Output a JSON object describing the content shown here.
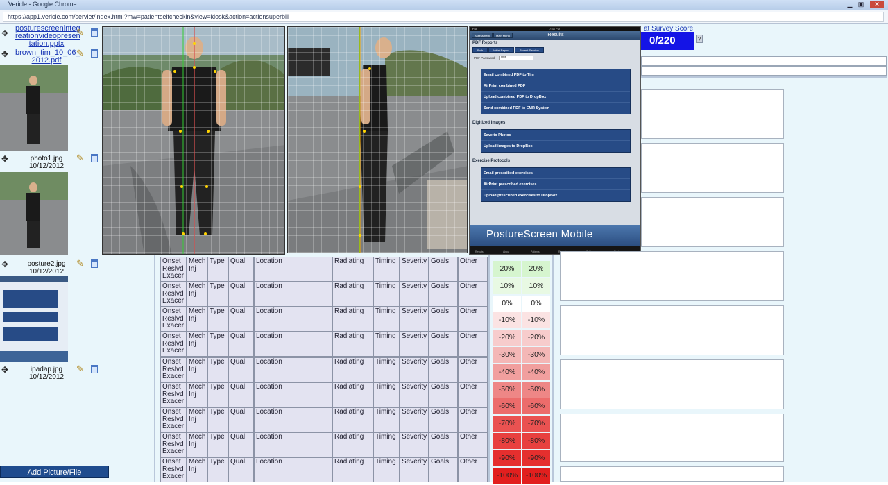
{
  "browser": {
    "window_title": "Vericle - Google Chrome",
    "url": "https://app1.vericle.com/servlet/index.html?mw=patientselfcheckin&view=kiosk&action=actionsuperbill"
  },
  "files": [
    {
      "name_lines": [
        "posturescreeninteg",
        "reationvideopresen",
        "tation.pptx"
      ],
      "date": "",
      "link": true
    },
    {
      "name_lines": [
        "brown_tim_10_06_",
        "2012.pdf"
      ],
      "date": "",
      "link": true
    },
    {
      "name_lines": [
        "photo1.jpg"
      ],
      "date": "10/12/2012",
      "link": false
    },
    {
      "name_lines": [
        "posture2.jpg"
      ],
      "date": "10/12/2012",
      "link": false
    },
    {
      "name_lines": [
        "ipadap.jpg"
      ],
      "date": "10/12/2012",
      "link": false
    }
  ],
  "add_button": "Add Picture/File",
  "ipad": {
    "status_left": "iPad",
    "status_time": "7:33 PM",
    "nav_left": "Assessment",
    "nav_mid": "Main Menu",
    "nav_title": "Results",
    "pdf_section": "PDF Reports",
    "pdf_tabs": [
      "Both",
      "Initial Report",
      "Recent Session"
    ],
    "pdf_password_label": "PDF Password",
    "pdf_password_value": "****",
    "pdf_actions": [
      "Email combined PDF to Tim",
      "AirPrint combined PDF",
      "Upload combined PDF to DropBox",
      "Send combined PDF to EMR System"
    ],
    "images_section": "Digitized Images",
    "image_actions": [
      "Save to Photos",
      "Upload images to DropBox"
    ],
    "exercise_section": "Exercise Protocols",
    "exercise_actions": [
      "Email prescribed exercises",
      "AirPrint prescribed exercises",
      "Upload prescribed exercises to DropBox"
    ],
    "logo": "PostureScreen Mobile",
    "tabs": [
      "Results",
      "About",
      "Patients",
      "Report",
      "Settings",
      "Next"
    ]
  },
  "survey": {
    "title": "at Survey Score",
    "score": "0/220",
    "help": "?"
  },
  "complaint_headers": {
    "onset": [
      "Onset",
      "Reslvd",
      "Exacer"
    ],
    "mech": [
      "Mech",
      "Inj"
    ],
    "type": "Type",
    "qual": "Qual",
    "location": "Location",
    "radiating": "Radiating",
    "timing": "Timing",
    "severity": "Severity",
    "goals": "Goals",
    "other": "Other"
  },
  "pain_scale": [
    {
      "a": "20%",
      "b": "20%",
      "color": "#d6f5cf"
    },
    {
      "a": "10%",
      "b": "10%",
      "color": "#e8f9e3"
    },
    {
      "a": "0%",
      "b": "0%",
      "color": "#ffffff"
    },
    {
      "a": "-10%",
      "b": "-10%",
      "color": "#fbe3e3"
    },
    {
      "a": "-20%",
      "b": "-20%",
      "color": "#f7cccc"
    },
    {
      "a": "-30%",
      "b": "-30%",
      "color": "#f4b7b6"
    },
    {
      "a": "-40%",
      "b": "-40%",
      "color": "#f19f9e"
    },
    {
      "a": "-50%",
      "b": "-50%",
      "color": "#ee8786"
    },
    {
      "a": "-60%",
      "b": "-60%",
      "color": "#ec6c6b"
    },
    {
      "a": "-70%",
      "b": "-70%",
      "color": "#ea5251"
    },
    {
      "a": "-80%",
      "b": "-80%",
      "color": "#e8403f"
    },
    {
      "a": "-90%",
      "b": "-90%",
      "color": "#e52f2e"
    },
    {
      "a": "-100%",
      "b": "-100%",
      "color": "#e21f1e"
    }
  ],
  "colors": {
    "link": "#1a37b5",
    "page_bg": "#e9f6fb",
    "cell_bg": "#e3e3f1",
    "score_bg": "#1414e6",
    "add_btn": "#1f4c8e",
    "ipad_button": "#274b86"
  }
}
